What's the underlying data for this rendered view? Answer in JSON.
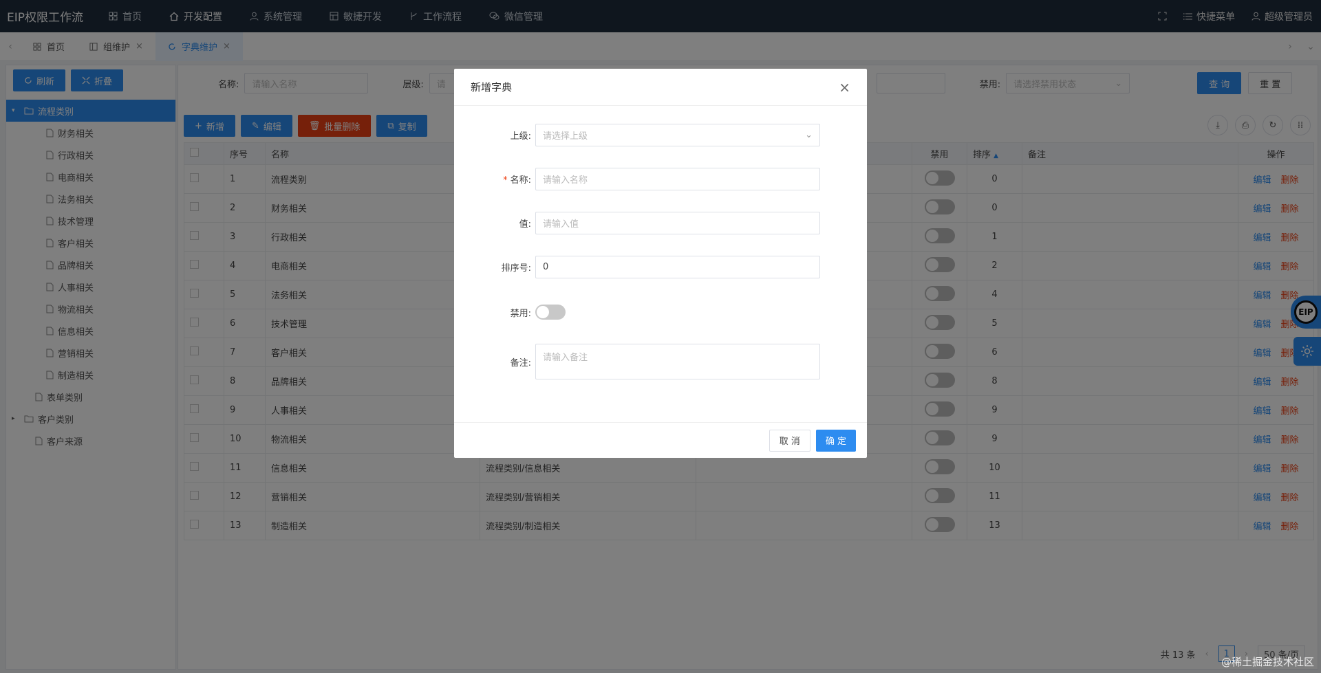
{
  "topbar": {
    "brand": "EIP权限工作流",
    "nav": [
      {
        "label": "首页",
        "icon": "grid-icon"
      },
      {
        "label": "开发配置",
        "icon": "home-icon"
      },
      {
        "label": "系统管理",
        "icon": "user-icon"
      },
      {
        "label": "敏捷开发",
        "icon": "table-icon"
      },
      {
        "label": "工作流程",
        "icon": "branch-icon"
      },
      {
        "label": "微信管理",
        "icon": "wechat-icon"
      }
    ],
    "right": {
      "shortcut": "快捷菜单",
      "user": "超级管理员"
    }
  },
  "tabs": [
    {
      "label": "首页"
    },
    {
      "label": "组维护"
    },
    {
      "label": "字典维护"
    }
  ],
  "sidebar": {
    "refresh_label": "刷新",
    "collapse_label": "折叠",
    "tree_root": "流程类别",
    "tree_children": [
      "财务相关",
      "行政相关",
      "电商相关",
      "法务相关",
      "技术管理",
      "客户相关",
      "品牌相关",
      "人事相关",
      "物流相关",
      "信息相关",
      "营销相关",
      "制造相关"
    ],
    "tree_others": [
      "表单类别",
      "客户类别",
      "客户来源"
    ]
  },
  "filter": {
    "name_label": "名称:",
    "name_placeholder": "请输入名称",
    "level_label": "层级:",
    "level_placeholder": "请",
    "disabled_label": "禁用:",
    "disabled_placeholder": "请选择禁用状态",
    "query_label": "查 询",
    "reset_label": "重 置"
  },
  "toolbar": {
    "add": "新增",
    "edit": "编辑",
    "batch_delete": "批量删除",
    "copy": "复制"
  },
  "table": {
    "headers": {
      "index": "序号",
      "name": "名称",
      "disabled": "禁用",
      "order": "排序",
      "remark": "备注",
      "ops": "操作"
    },
    "op_edit": "编辑",
    "op_delete": "删除",
    "rows": [
      {
        "no": "1",
        "name": "流程类别",
        "path": "",
        "order": "0"
      },
      {
        "no": "2",
        "name": "财务相关",
        "path": "",
        "order": "0"
      },
      {
        "no": "3",
        "name": "行政相关",
        "path": "",
        "order": "1"
      },
      {
        "no": "4",
        "name": "电商相关",
        "path": "",
        "order": "2"
      },
      {
        "no": "5",
        "name": "法务相关",
        "path": "",
        "order": "4"
      },
      {
        "no": "6",
        "name": "技术管理",
        "path": "",
        "order": "5"
      },
      {
        "no": "7",
        "name": "客户相关",
        "path": "",
        "order": "6"
      },
      {
        "no": "8",
        "name": "品牌相关",
        "path": "",
        "order": "8"
      },
      {
        "no": "9",
        "name": "人事相关",
        "path": "",
        "order": "9"
      },
      {
        "no": "10",
        "name": "物流相关",
        "path": "",
        "order": "9"
      },
      {
        "no": "11",
        "name": "信息相关",
        "path": "流程类别/信息相关",
        "order": "10"
      },
      {
        "no": "12",
        "name": "营销相关",
        "path": "流程类别/营销相关",
        "order": "11"
      },
      {
        "no": "13",
        "name": "制造相关",
        "path": "流程类别/制造相关",
        "order": "13"
      }
    ]
  },
  "pager": {
    "total": "共 13 条",
    "page": "1",
    "size": "50 条/页"
  },
  "float": {
    "eip": "EIP"
  },
  "modal": {
    "title": "新增字典",
    "parent_label": "上级:",
    "parent_placeholder": "请选择上级",
    "name_label": "名称:",
    "name_placeholder": "请输入名称",
    "value_label": "值:",
    "value_placeholder": "请输入值",
    "order_label": "排序号:",
    "order_value": "0",
    "disabled_label": "禁用:",
    "remark_label": "备注:",
    "remark_placeholder": "请输入备注",
    "cancel": "取 消",
    "ok": "确 定"
  },
  "watermark": "@稀土掘金技术社区"
}
